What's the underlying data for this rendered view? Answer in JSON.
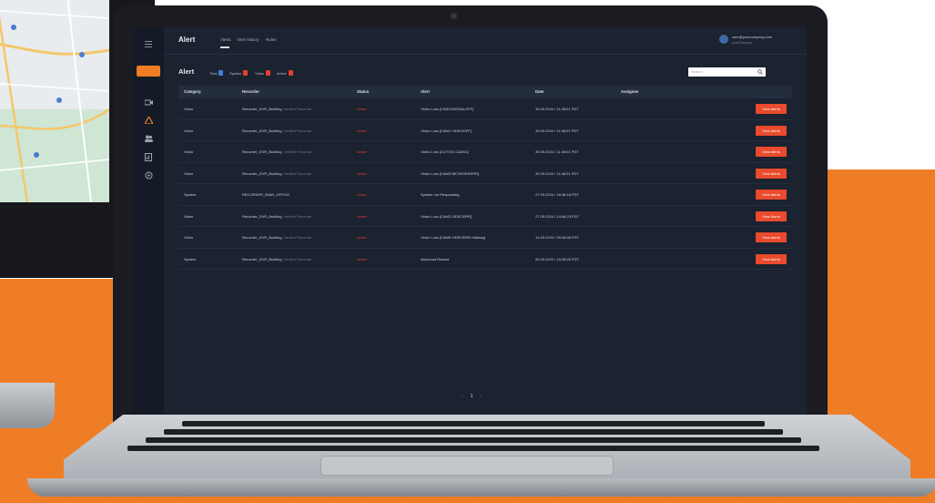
{
  "colors": {
    "accent": "#ef7d26",
    "view_button": "#ea4a2d",
    "status_active": "#e5412f",
    "badge_total": "#3f7fd8",
    "badge_red": "#e5412f",
    "screen_bg": "#1b2230"
  },
  "app": {
    "title": "Alert",
    "nav_tabs": [
      {
        "label": "Alerts"
      },
      {
        "label": "Alert History"
      },
      {
        "label": "Rules"
      }
    ],
    "user": {
      "email": "user@yourcompany.com",
      "subtitle": "yourCompany"
    }
  },
  "sidebar": {
    "icons": [
      "menu-icon",
      "camera-icon",
      "warning-icon",
      "users-icon",
      "report-icon",
      "settings-icon"
    ]
  },
  "page": {
    "title": "Alert",
    "counts": [
      {
        "label": "Total",
        "value": "8"
      },
      {
        "label": "System",
        "value": "2"
      },
      {
        "label": "Video",
        "value": "6"
      },
      {
        "label": "Active",
        "value": "8"
      }
    ],
    "search_placeholder": "Search"
  },
  "table": {
    "columns": [
      "Category",
      "Recorder",
      "Status",
      "Alert",
      "Date",
      "Assignee"
    ],
    "view_label": "View Alerts",
    "rows": [
      {
        "category": "Video",
        "recorder": "Recorder_DVR_Building",
        "recorder_extra": "Verified Recorder",
        "status": "Active",
        "alert": "Video Loss [VIDEOSIGNALOFF]",
        "date": "30.09.2024 / 11:48:01 PDT"
      },
      {
        "category": "Video",
        "recorder": "Recorder_DVR_Building",
        "recorder_extra": "Verified Recorder",
        "status": "Active",
        "alert": "Video Loss [CAM1 VIDEOOFF]",
        "date": "30.09.2024 / 11:48:01 PDT"
      },
      {
        "category": "Video",
        "recorder": "Recorder_DVR_Building",
        "recorder_extra": "Verified Recorder",
        "status": "Active",
        "alert": "Video Loss [CCTV01 CAM11]",
        "date": "30.09.2024 / 11:48:01 PDT"
      },
      {
        "category": "Video",
        "recorder": "Recorder_DVR_Building",
        "recorder_extra": "Verified Recorder",
        "status": "Active",
        "alert": "Video Loss [CAM3 NETWORKERR]",
        "date": "30.09.2024 / 11:48:01 PDT"
      },
      {
        "category": "System",
        "recorder": "RECORDER_MAIN_OFFICE",
        "recorder_extra": "",
        "status": "Active",
        "alert": "System not Responding",
        "date": "27.09.2024 / 16:48:18 PDT"
      },
      {
        "category": "Video",
        "recorder": "Recorder_DVR_Building",
        "recorder_extra": "Verified Recorder",
        "status": "Active",
        "alert": "Video Loss [CAM2 VIDEOERR]",
        "date": "27.09.2024 / 14:58:23 PDT"
      },
      {
        "category": "Video",
        "recorder": "Recorder_DVR_Building",
        "recorder_extra": "Verified Recorder",
        "status": "Active",
        "alert": "Video Loss [CAM5 VIDEOERR Hallway]",
        "date": "14.09.2024 / 09:18:08 PDT"
      },
      {
        "category": "System",
        "recorder": "Recorder_DVR_Building",
        "recorder_extra": "Verified Recorder",
        "status": "Active",
        "alert": "Abnormal Restart",
        "date": "05.09.2024 / 15:28:26 PDT"
      }
    ]
  },
  "pagination": {
    "prev": "‹",
    "current": "1",
    "next": "›"
  }
}
